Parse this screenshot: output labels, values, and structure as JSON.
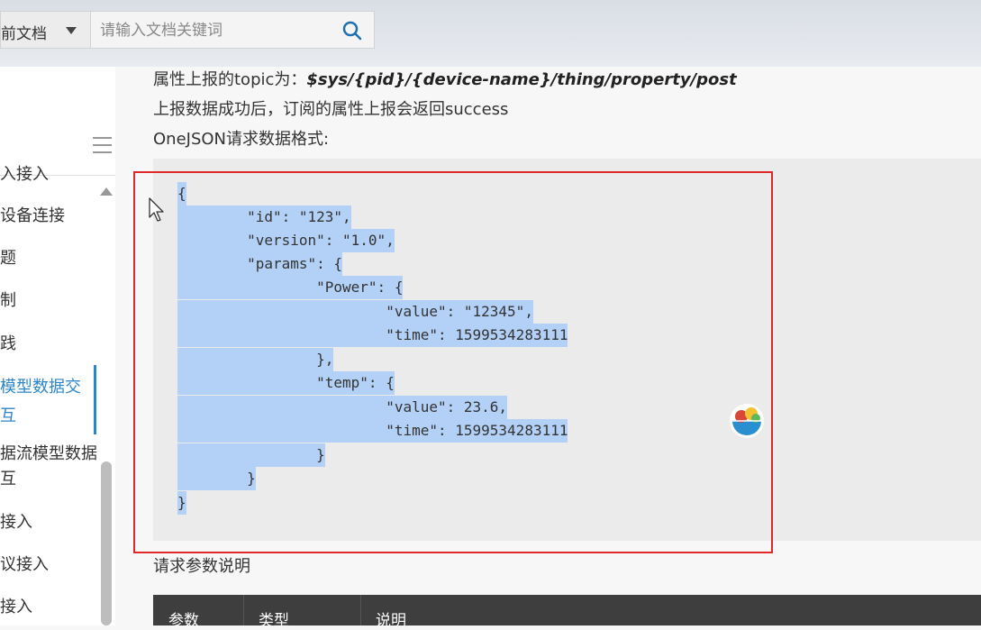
{
  "topbar": {
    "scope_label": "前文档",
    "search_placeholder": "请输入文档关键词"
  },
  "sidebar": {
    "items": [
      {
        "label": "入接入",
        "active": false
      },
      {
        "label": "设备连接",
        "active": false
      },
      {
        "label": "题",
        "active": false
      },
      {
        "label": "制",
        "active": false
      },
      {
        "label": "践",
        "active": false
      },
      {
        "label": "模型数据交",
        "active": true
      },
      {
        "label": "互",
        "active": true
      },
      {
        "label": "据流模型数据",
        "active": false
      },
      {
        "label": "互",
        "active": false
      },
      {
        "label": "接入",
        "active": false
      },
      {
        "label": "议接入",
        "active": false
      },
      {
        "label": "接入",
        "active": false
      }
    ]
  },
  "content": {
    "topic_prefix": "属性上报的topic为：",
    "topic_value": "$sys/{pid}/{device-name}/thing/property/post",
    "success_text": "上报数据成功后，订阅的属性上报会返回success",
    "format_text": "OneJSON请求数据格式:",
    "code_lines": [
      "{",
      "        \"id\": \"123\",",
      "        \"version\": \"1.0\",",
      "        \"params\": {",
      "                \"Power\": {",
      "                        \"value\": \"12345\",",
      "                        \"time\": 1599534283111",
      "                },",
      "                \"temp\": {",
      "                        \"value\": 23.6,",
      "                        \"time\": 1599534283111",
      "                }",
      "        }",
      "}"
    ],
    "request_params_title": "请求参数说明",
    "table_headers": [
      "参数",
      "类型",
      "说明"
    ]
  }
}
